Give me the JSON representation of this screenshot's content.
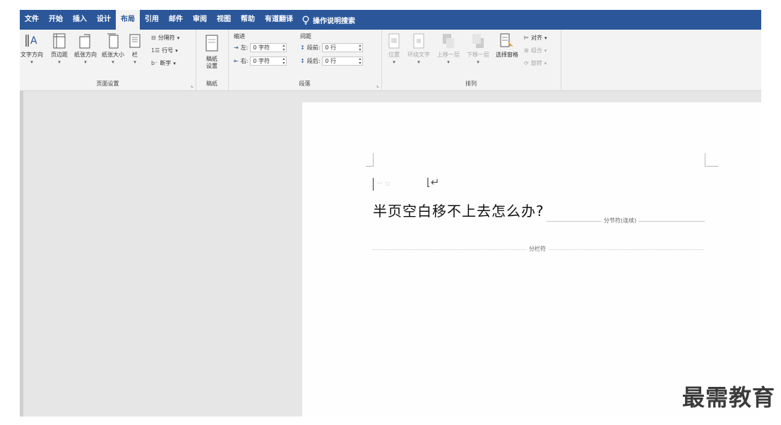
{
  "tabs": [
    "文件",
    "开始",
    "插入",
    "设计",
    "布局",
    "引用",
    "邮件",
    "审阅",
    "视图",
    "帮助",
    "有道翻译"
  ],
  "active_tab": "布局",
  "tell_me": "操作说明搜索",
  "ribbon": {
    "page_setup": {
      "label": "页面设置",
      "text_direction": "文字方向",
      "margins": "页边距",
      "orientation": "纸张方向",
      "size": "纸张大小",
      "columns": "栏",
      "breaks": "分隔符",
      "line_numbers": "行号",
      "hyphenation": "断字"
    },
    "manuscript": {
      "label": "稿纸",
      "settings_line1": "稿纸",
      "settings_line2": "设置"
    },
    "paragraph": {
      "label": "段落",
      "indent_title": "缩进",
      "spacing_title": "间距",
      "indent_left_label": "左:",
      "indent_left_value": "0 字符",
      "indent_right_label": "右:",
      "indent_right_value": "0 字符",
      "spacing_before_label": "段前:",
      "spacing_before_value": "0 行",
      "spacing_after_label": "段后:",
      "spacing_after_value": "0 行"
    },
    "arrange": {
      "label": "排列",
      "position": "位置",
      "wrap_text": "环绕文字",
      "bring_forward": "上移一层",
      "send_backward": "下移一层",
      "selection_pane": "选择窗格",
      "align": "对齐",
      "group": "组合",
      "rotate": "旋转"
    }
  },
  "document": {
    "heading": "半页空白移不上去怎么办?",
    "section_break_label": "分节符(连续)",
    "column_break_label": "分栏符"
  },
  "watermark": "最需教育",
  "colors": {
    "accent": "#2b579a",
    "ribbon_bg": "#f3f3f3",
    "workspace": "#e6e6e6"
  }
}
